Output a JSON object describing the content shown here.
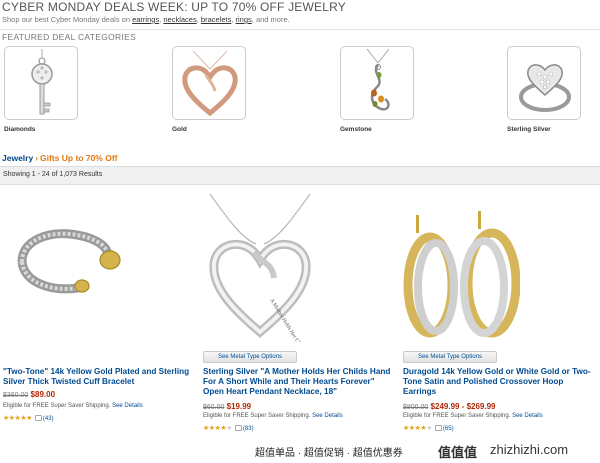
{
  "banner": {
    "title": "CYBER MONDAY DEALS WEEK: UP TO 70% OFF JEWELRY",
    "subtitle_prefix": "Shop our best Cyber Monday deals on",
    "links": [
      "earrings",
      "necklaces",
      "bracelets",
      "rings"
    ],
    "subtitle_suffix": "and more."
  },
  "featured": {
    "title": "FEATURED DEAL CATEGORIES",
    "categories": [
      {
        "label": "Diamonds",
        "icon": "diamond-key-pendant-icon"
      },
      {
        "label": "Gold",
        "icon": "rose-gold-heart-pendant-icon"
      },
      {
        "label": "Gemstone",
        "icon": "gemstone-pendant-icon"
      },
      {
        "label": "Sterling Silver",
        "icon": "silver-heart-ring-icon"
      }
    ]
  },
  "breadcrumb": {
    "root": "Jewelry",
    "separator": "›",
    "current": "Gifts Up to 70% Off"
  },
  "results": {
    "text": "Showing 1 - 24 of 1,073 Results"
  },
  "products": [
    {
      "title": "\"Two-Tone\" 14k Yellow Gold Plated and Sterling Silver Thick Twisted Cuff Bracelet",
      "list_price": "$360.00",
      "sale_price": "$89.00",
      "ship_text": "Eligible for FREE Super Saver Shipping.",
      "ship_link": "See Details",
      "rating": 5,
      "reviews": "(43)",
      "option_button": ""
    },
    {
      "title": "Sterling Silver \"A Mother Holds Her Childs Hand For A Short While and Their Hearts Forever\" Open Heart Pendant Necklace, 18\"",
      "list_price": "$60.00",
      "sale_price": "$19.99",
      "ship_text": "Eligible for FREE Super Saver Shipping.",
      "ship_link": "See Details",
      "rating": 4,
      "reviews": "(83)",
      "option_button": "See Metal Type Options",
      "engraving": "A Mother Holds Her Child's Hand"
    },
    {
      "title": "Duragold 14k Yellow Gold or White Gold or Two-Tone Satin and Polished Crossover Hoop Earrings",
      "list_price": "$800.00",
      "sale_price": "$249.99 - $269.99",
      "ship_text": "Eligible for FREE Super Saver Shipping.",
      "ship_link": "See Details",
      "rating": 4,
      "reviews": "(65)",
      "option_button": "See Metal Type Options"
    }
  ],
  "watermark": {
    "text": "超值单品 · 超值促销 · 超值优惠券",
    "logo": "值值值",
    "url": "zhizhizhi.com"
  },
  "colors": {
    "link_blue": "#004b91",
    "breadcrumb_orange": "#e47911",
    "price_red": "#b12704",
    "star_gold": "#e6a31a"
  }
}
